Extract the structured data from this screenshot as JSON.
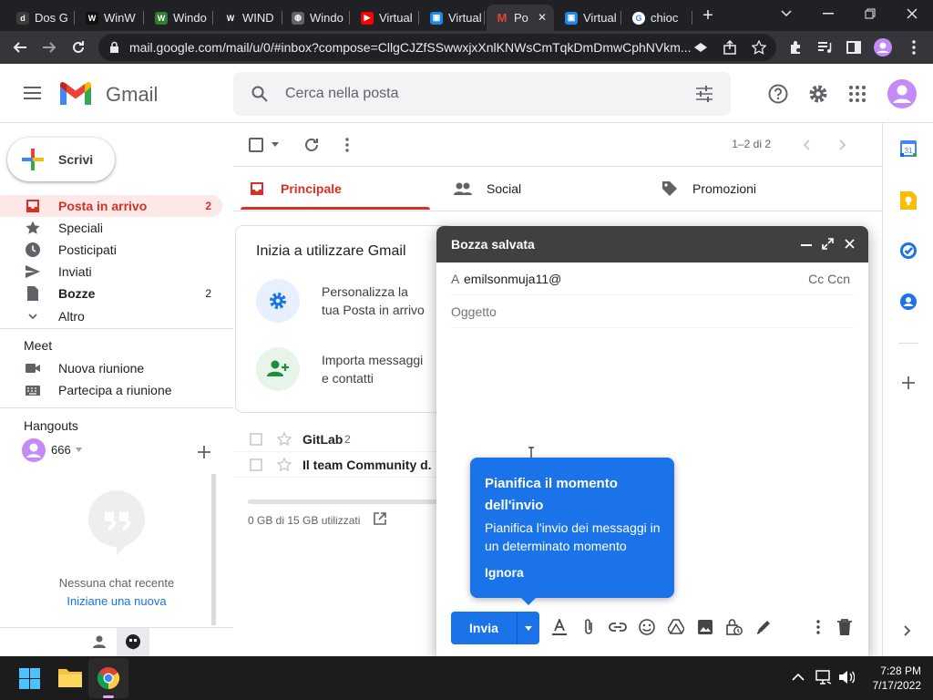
{
  "browser": {
    "tabs": [
      {
        "label": "Dos G",
        "fav_color": "#3c3c3c",
        "fav_glyph": "d"
      },
      {
        "label": "WinW",
        "fav_color": "#111111",
        "fav_glyph": "W"
      },
      {
        "label": "Windo",
        "fav_color": "#2e7d32",
        "fav_glyph": "W"
      },
      {
        "label": "WIND",
        "fav_color": "#222222",
        "fav_glyph": "W"
      },
      {
        "label": "Windo",
        "fav_color": "#5f6368",
        "fav_glyph": "◍"
      },
      {
        "label": "Virtual",
        "fav_color": "#ff0000",
        "fav_glyph": "▶"
      },
      {
        "label": "Virtual",
        "fav_color": "#1e88e5",
        "fav_glyph": "▣"
      },
      {
        "label": "Po",
        "fav_color": "#ea4335",
        "fav_glyph": "M"
      },
      {
        "label": "Virtual",
        "fav_color": "#1e88e5",
        "fav_glyph": "▣"
      },
      {
        "label": "chioc",
        "fav_color": "#ffffff",
        "fav_glyph": "G"
      }
    ],
    "new_tab": "+",
    "url": "mail.google.com/mail/u/0/#inbox?compose=CllgCJZfSSwwxjxXnlKNWsCmTqkDmDmwCphNVkm...",
    "accent": "#8ab4f8"
  },
  "gmail": {
    "brand": "Gmail",
    "search_placeholder": "Cerca nella posta",
    "compose_button": "Scrivi",
    "nav": [
      {
        "label": "Posta in arrivo",
        "count": "2",
        "icon": "inbox-icon"
      },
      {
        "label": "Speciali",
        "count": "",
        "icon": "star-icon"
      },
      {
        "label": "Posticipati",
        "count": "",
        "icon": "clock-icon"
      },
      {
        "label": "Inviati",
        "count": "",
        "icon": "send-icon"
      },
      {
        "label": "Bozze",
        "count": "2",
        "icon": "draft-icon"
      },
      {
        "label": "Altro",
        "count": "",
        "icon": "chevron-down-icon"
      }
    ],
    "meet": {
      "title": "Meet",
      "items": [
        "Nuova riunione",
        "Partecipa a riunione"
      ]
    },
    "hangouts": {
      "title": "Hangouts",
      "user": "666",
      "empty_text": "Nessuna chat recente",
      "start_link": "Iniziane una nuova"
    },
    "toolbar": {
      "pagination": "1–2 di 2"
    },
    "categories": [
      "Principale",
      "Social",
      "Promozioni"
    ],
    "getting_started": {
      "title": "Inizia a utilizzare Gmail",
      "items": [
        {
          "line1": "Personalizza la",
          "line2": "tua Posta in arrivo"
        },
        {
          "line1": "Importa messaggi",
          "line2": "e contatti"
        }
      ]
    },
    "emails": [
      {
        "sender": "GitLab",
        "count": "2"
      },
      {
        "sender": "Il team Community d.",
        "count": ""
      }
    ],
    "storage": "0 GB di 15 GB utilizzati",
    "compose": {
      "title": "Bozza salvata",
      "to_label": "A",
      "to_value": "emilsonmuja11@",
      "cc_bcc": "Cc Ccn",
      "subject_placeholder": "Oggetto",
      "send_label": "Invia"
    },
    "tooltip": {
      "title": "Pianifica il momento dell'invio",
      "body": "Pianifica l'invio dei messaggi in un determinato momento",
      "dismiss": "Ignora"
    },
    "colors": {
      "red": "#d93025",
      "blue": "#1a73e8",
      "tooltip": "#1a73e8"
    }
  },
  "taskbar": {
    "time": "7:28 PM",
    "date": "7/17/2022"
  }
}
